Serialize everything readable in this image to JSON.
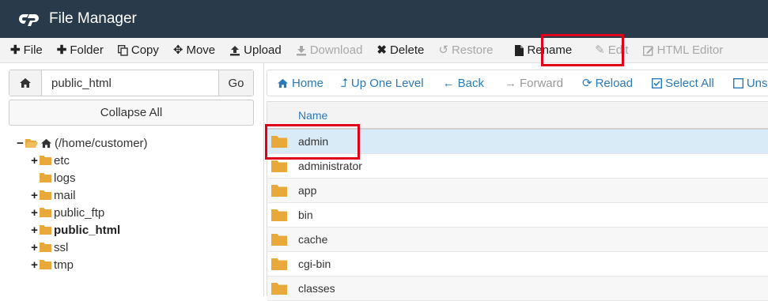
{
  "app": {
    "title": "File Manager"
  },
  "toolbar": {
    "items": [
      {
        "label": "File",
        "icon": "plus-icon",
        "enabled": true
      },
      {
        "label": "Folder",
        "icon": "plus-icon",
        "enabled": true
      },
      {
        "label": "Copy",
        "icon": "copy-icon",
        "enabled": true
      },
      {
        "label": "Move",
        "icon": "move-icon",
        "enabled": true
      },
      {
        "label": "Upload",
        "icon": "upload-icon",
        "enabled": true
      },
      {
        "label": "Download",
        "icon": "download-icon",
        "enabled": false
      },
      {
        "label": "Delete",
        "icon": "x-icon",
        "enabled": true
      },
      {
        "label": "Restore",
        "icon": "restore-icon",
        "enabled": false
      },
      {
        "label": "Rename",
        "icon": "file-icon",
        "enabled": true
      },
      {
        "label": "Edit",
        "icon": "pencil-icon",
        "enabled": false
      },
      {
        "label": "HTML Editor",
        "icon": "edit-box-icon",
        "enabled": false
      }
    ]
  },
  "sidebar": {
    "path_value": "public_html",
    "go_label": "Go",
    "collapse_label": "Collapse All",
    "tree": [
      {
        "label": "(/home/customer)",
        "toggle": "−",
        "depth": 0,
        "root": true
      },
      {
        "label": "etc",
        "toggle": "+",
        "depth": 1
      },
      {
        "label": "logs",
        "toggle": "",
        "depth": 1
      },
      {
        "label": "mail",
        "toggle": "+",
        "depth": 1
      },
      {
        "label": "public_ftp",
        "toggle": "+",
        "depth": 1
      },
      {
        "label": "public_html",
        "toggle": "+",
        "depth": 1,
        "bold": true
      },
      {
        "label": "ssl",
        "toggle": "+",
        "depth": 1
      },
      {
        "label": "tmp",
        "toggle": "+",
        "depth": 1
      }
    ]
  },
  "nav": {
    "items": [
      {
        "label": "Home",
        "enabled": true
      },
      {
        "label": "Up One Level",
        "enabled": true
      },
      {
        "label": "Back",
        "enabled": true
      },
      {
        "label": "Forward",
        "enabled": false
      },
      {
        "label": "Reload",
        "enabled": true
      },
      {
        "label": "Select All",
        "enabled": true
      },
      {
        "label": "Unselect",
        "enabled": true
      }
    ]
  },
  "table": {
    "column_name": "Name",
    "rows": [
      {
        "name": "admin",
        "selected": true
      },
      {
        "name": "administrator"
      },
      {
        "name": "app"
      },
      {
        "name": "bin"
      },
      {
        "name": "cache"
      },
      {
        "name": "cgi-bin"
      },
      {
        "name": "classes"
      }
    ]
  },
  "colors": {
    "header_bg": "#293a4a",
    "link_blue": "#2a7ab8",
    "folder": "#e8a93a",
    "highlight_red": "#e0001a",
    "selected_row": "#d9ebf7"
  }
}
